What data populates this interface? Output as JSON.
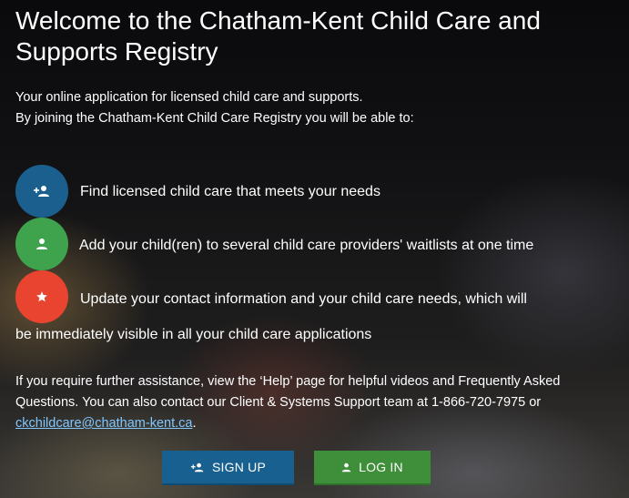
{
  "page": {
    "title": "Welcome to the Chatham-Kent Child Care and Supports Registry",
    "intro_line1": "Your online application for licensed child care and supports.",
    "intro_line2": "By joining the Chatham-Kent Child Care Registry you will be able to:"
  },
  "features": [
    {
      "icon": "add-person-icon",
      "color": "#1a5f8e",
      "text": "Find licensed child care that meets your needs"
    },
    {
      "icon": "person-icon",
      "color": "#3fa34d",
      "text": "Add your child(ren) to several child care providers' waitlists at one time"
    },
    {
      "icon": "star-icon",
      "color": "#e8442f",
      "text_line1": "Update your contact information and your child care needs, which will",
      "text_line2": "be immediately visible in all your child care applications"
    }
  ],
  "help": {
    "text_before": "If you require further assistance, view the ‘Help’ page for helpful videos and Frequently Asked Questions.  You can also contact our Client & Systems Support team at 1-866-720-7975 or ",
    "email": "ckchildcare@chatham-kent.ca",
    "text_after": "."
  },
  "buttons": {
    "signup_label": "SIGN UP",
    "signup_icon": "add-person-icon",
    "signup_color": "#18608f",
    "login_label": "LOG IN",
    "login_icon": "person-icon",
    "login_color": "#3f8f3a"
  }
}
